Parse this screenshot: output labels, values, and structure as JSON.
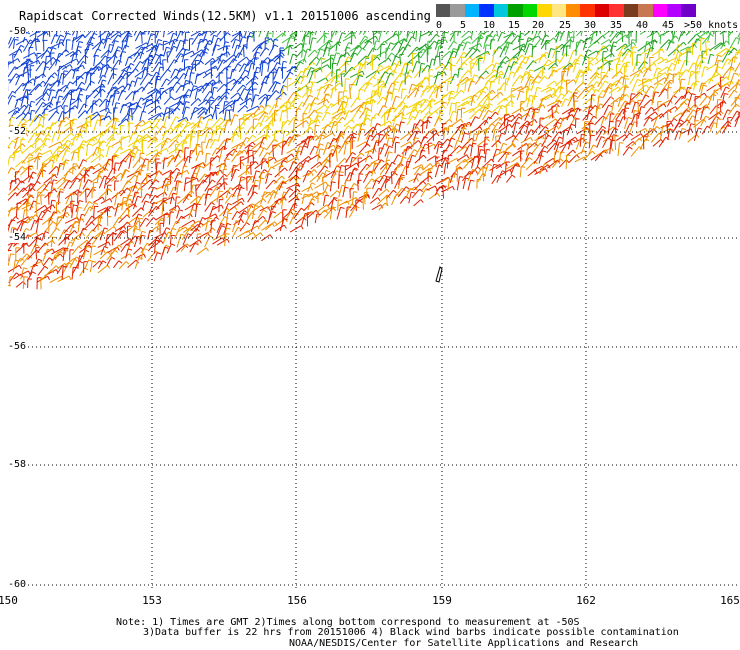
{
  "title": "Rapidscat Corrected Winds(12.5KM) v1.1 20151006 ascending",
  "legend": {
    "colors": [
      "#555555",
      "#9a9a9a",
      "#00b4ff",
      "#0032ff",
      "#00c8dc",
      "#00a000",
      "#00d800",
      "#ffd700",
      "#ffe680",
      "#ff8c00",
      "#ff3200",
      "#dc0000",
      "#ff3232",
      "#7a3c1e",
      "#c87850",
      "#ff00ff",
      "#b400ff",
      "#7000c8"
    ],
    "tick_labels": [
      "0",
      "5",
      "10",
      "15",
      "20",
      "25",
      "30",
      "35",
      "40",
      "45",
      ">50 knots"
    ]
  },
  "map": {
    "lon_labels": [
      "150",
      "153",
      "156",
      "159",
      "162",
      "165"
    ],
    "lat_labels": [
      "-50",
      "-52",
      "-54",
      "-56",
      "-58",
      "-60"
    ],
    "barb_colors": {
      "blue": "#1040d0",
      "green": "#20a020",
      "light_green": "#40c040",
      "yellow": "#f0d000",
      "orange": "#f09000",
      "red": "#e02000",
      "black": "#000000"
    }
  },
  "notes": {
    "line1": "Note: 1) Times are GMT 2)Times along bottom correspond to measurement at -50S",
    "line2": "3)Data buffer is 22 hrs from 20151006 4) Black wind barbs indicate possible contamination",
    "line3": "NOAA/NESDIS/Center for Satellite Applications and Research"
  }
}
